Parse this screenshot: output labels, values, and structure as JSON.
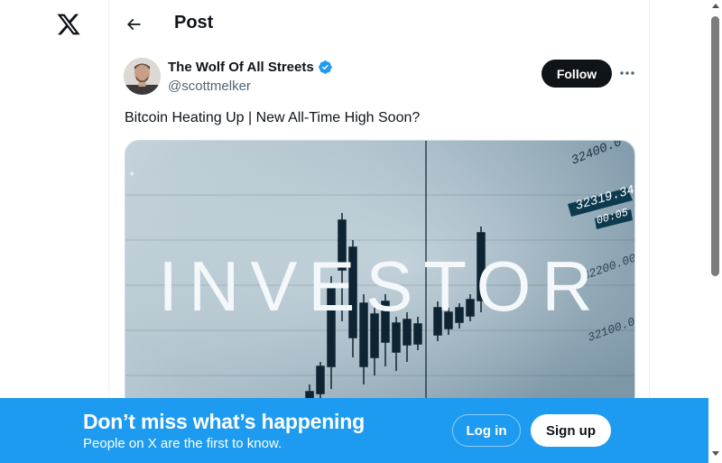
{
  "header": {
    "title": "Post"
  },
  "post": {
    "author_name": "The Wolf Of All Streets",
    "handle": "@scottmelker",
    "follow_label": "Follow",
    "text": "Bitcoin Heating Up | New All-Time High Soon?",
    "media": {
      "overlay_word": "INVESTOR",
      "price_labels": [
        "32400.0",
        "32319.34",
        "00:05",
        "32200.00",
        "32100.0",
        "32"
      ]
    }
  },
  "bottom_bar": {
    "headline": "Don’t miss what’s happening",
    "subtext": "People on X are the first to know.",
    "login_label": "Log in",
    "signup_label": "Sign up"
  },
  "colors": {
    "accent": "#1d9bf0",
    "text": "#0f1419",
    "muted": "#536471",
    "verified": "#1d9bf0"
  }
}
